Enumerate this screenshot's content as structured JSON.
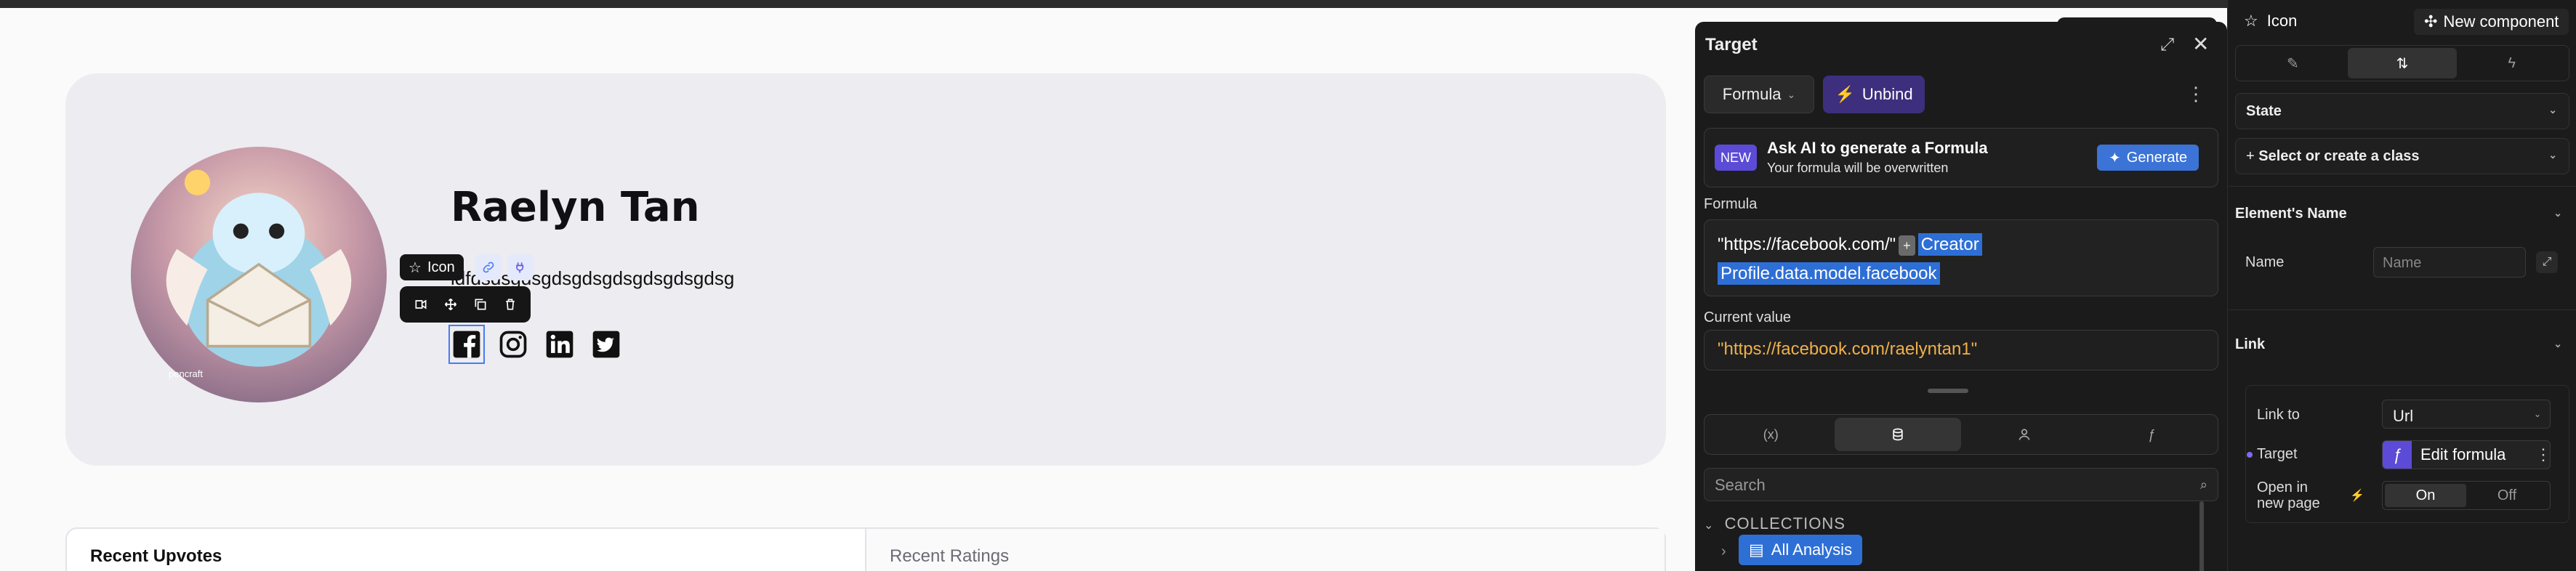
{
  "canvas": {
    "profile": {
      "name": "Raelyn Tan",
      "bio": "ldfdsdsgdsgdsgdsgdsgdsgdsgdsg",
      "avatar_caption": "pencraft",
      "socials": [
        "facebook-icon",
        "instagram-icon",
        "linkedin-icon",
        "twitter-icon"
      ]
    },
    "element_tag": {
      "label": "Icon"
    },
    "tabs": [
      "Recent Upvotes",
      "Recent Ratings"
    ]
  },
  "target_panel": {
    "title": "Target",
    "formula_btn": "Formula",
    "unbind_btn": "Unbind",
    "ai": {
      "badge": "NEW",
      "title": "Ask AI to generate a Formula",
      "subtitle": "Your formula will be overwritten",
      "generate": "Generate"
    },
    "formula_label": "Formula",
    "formula_text": "\"https://facebook.com/\"",
    "formula_plus": "+",
    "formula_token_1": "Creator",
    "formula_token_2": "Profile.data.model.facebook",
    "current_value_label": "Current value",
    "current_value": "\"https://facebook.com/raelyntan1\"",
    "tab_icons": [
      "(x)",
      "db",
      "user",
      "f"
    ],
    "search_placeholder": "Search",
    "collections_label": "COLLECTIONS",
    "collection_item": "All Analysis"
  },
  "sidebar": {
    "title": "Icon",
    "new_component": "New component",
    "state": "State",
    "class_select": "Select or create a class",
    "element_name_section": "Element's Name",
    "name_label": "Name",
    "name_placeholder": "Name",
    "link_section": "Link",
    "link_to_label": "Link to",
    "link_to_value": "Url",
    "target_label": "Target",
    "edit_formula": "Edit formula",
    "open_new_page_label_1": "Open in",
    "open_new_page_label_2": "new page",
    "toggle_on": "On",
    "toggle_off": "Off"
  }
}
